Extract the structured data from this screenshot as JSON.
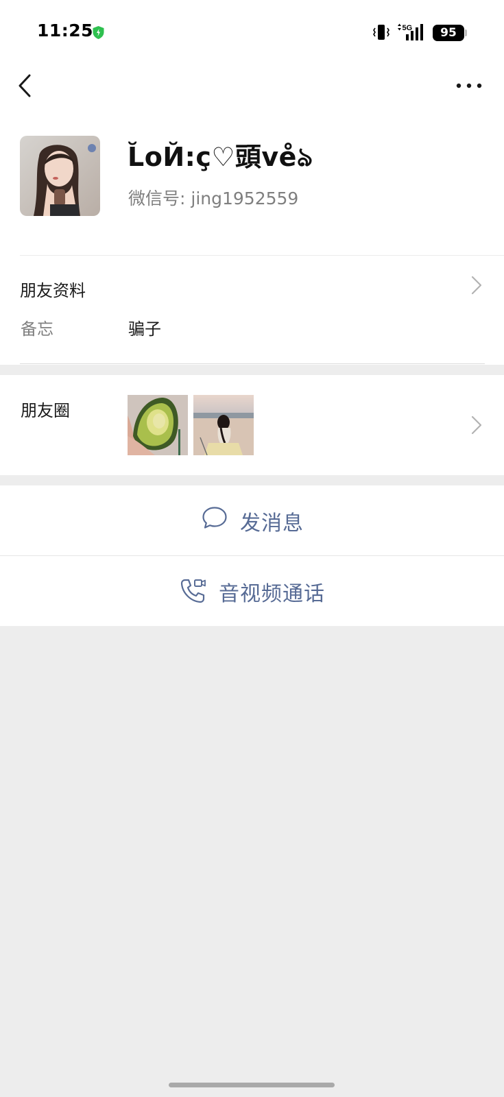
{
  "status_bar": {
    "time": "11:25",
    "network": "5G",
    "battery": "95",
    "icons": [
      "shield-icon",
      "vibrate-icon",
      "signal-icon",
      "battery-icon"
    ]
  },
  "nav": {
    "back_icon": "chevron-left-icon",
    "more_icon": "more-icon"
  },
  "profile": {
    "nickname": "L̆oЙ:ç♡頭ve̊ঌ",
    "wechat_id": "微信号: jing1952559"
  },
  "friend_info": {
    "title": "朋友资料",
    "remark_label": "备忘",
    "remark_value": "骗子"
  },
  "moments": {
    "title": "朋友圈"
  },
  "actions": {
    "message_label": "发消息",
    "call_label": "音视频通话"
  },
  "colors": {
    "link_blue": "#576b95",
    "background_gray": "#ededed",
    "shield_green": "#2ec04f"
  }
}
